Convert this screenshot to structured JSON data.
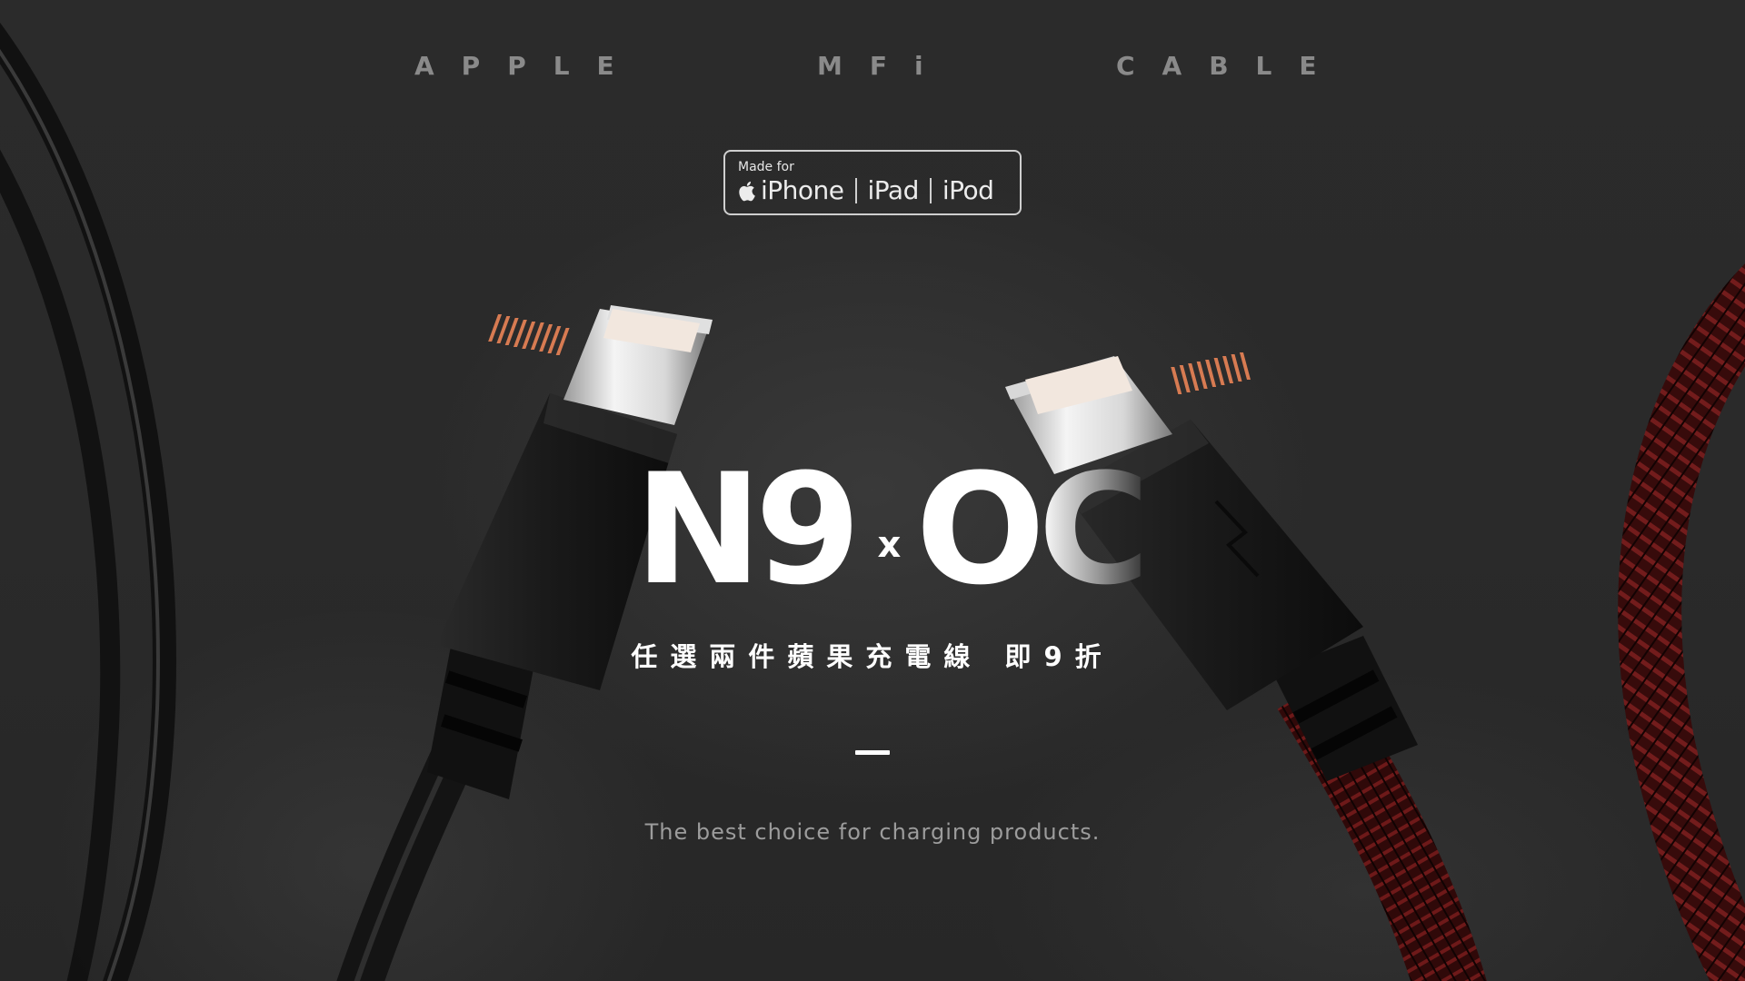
{
  "header": {
    "words": [
      "APPLE",
      "MFi",
      "CABLE"
    ]
  },
  "badge": {
    "made_for": "Made for",
    "devices": [
      "iPhone",
      "iPad",
      "iPod"
    ],
    "icon": "apple-icon"
  },
  "headline": {
    "left": "N9",
    "joiner": "x",
    "right": "OC"
  },
  "promo": {
    "text": "任選兩件蘋果充電線 即9折"
  },
  "tagline": {
    "text": "The best choice for charging products."
  },
  "colors": {
    "background": "#2a2a2a",
    "text_primary": "#ffffff",
    "text_muted": "#8a8a8a",
    "cable_black": "#151515",
    "cable_braid_red": "#6e1a1a"
  }
}
